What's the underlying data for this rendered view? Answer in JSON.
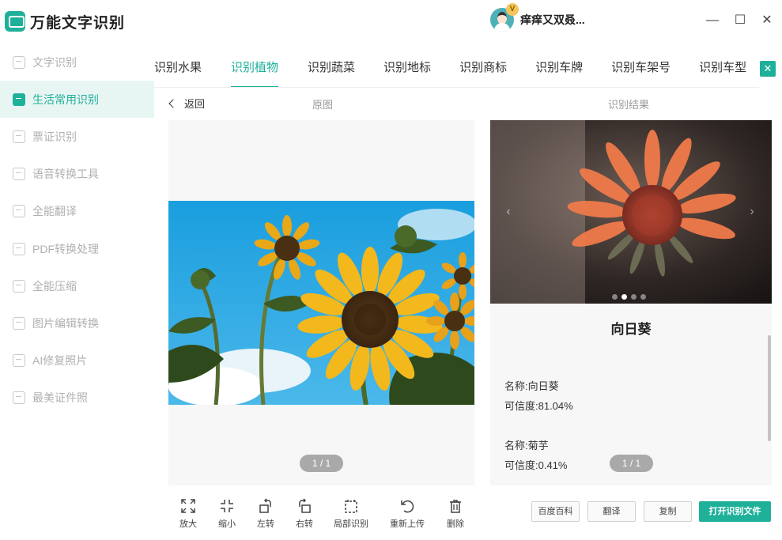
{
  "app": {
    "name": "万能文字识别"
  },
  "user": {
    "name": "痒痒又双叒...",
    "badge": "V"
  },
  "window": {
    "minimize": "—",
    "maximize": "☐",
    "close": "✕"
  },
  "sidebar": {
    "items": [
      {
        "label": "文字识别",
        "icon": "text-scan-icon"
      },
      {
        "label": "生活常用识别",
        "icon": "life-recognition-icon"
      },
      {
        "label": "票证识别",
        "icon": "ticket-scan-icon"
      },
      {
        "label": "语音转换工具",
        "icon": "voice-convert-icon"
      },
      {
        "label": "全能翻译",
        "icon": "translate-icon"
      },
      {
        "label": "PDF转换处理",
        "icon": "pdf-icon"
      },
      {
        "label": "全能压缩",
        "icon": "compress-icon"
      },
      {
        "label": "图片编辑转换",
        "icon": "image-edit-icon"
      },
      {
        "label": "AI修复照片",
        "icon": "ai-repair-icon"
      },
      {
        "label": "最美证件照",
        "icon": "id-photo-icon"
      }
    ]
  },
  "tabs": [
    {
      "label": "识别水果"
    },
    {
      "label": "识别植物"
    },
    {
      "label": "识别蔬菜"
    },
    {
      "label": "识别地标"
    },
    {
      "label": "识别商标"
    },
    {
      "label": "识别车牌"
    },
    {
      "label": "识别车架号"
    },
    {
      "label": "识别车型"
    }
  ],
  "tab_close": "✕",
  "subheader": {
    "back": "返回",
    "original": "原图",
    "result": "识别结果"
  },
  "left": {
    "page": "1 / 1"
  },
  "toolbar": [
    {
      "label": "放大",
      "icon": "zoom-in-icon"
    },
    {
      "label": "缩小",
      "icon": "zoom-out-icon"
    },
    {
      "label": "左转",
      "icon": "rotate-left-icon"
    },
    {
      "label": "右转",
      "icon": "rotate-right-icon"
    },
    {
      "label": "局部识别",
      "icon": "crop-icon"
    },
    {
      "label": "重新上传",
      "icon": "reupload-icon"
    },
    {
      "label": "删除",
      "icon": "delete-icon"
    }
  ],
  "result": {
    "title": "向日葵",
    "arrows": {
      "prev": "‹",
      "next": "›"
    },
    "items": [
      {
        "name": "名称:向日葵",
        "confidence": "可信度:81.04%"
      },
      {
        "name": "名称:菊芋",
        "confidence": "可信度:0.41%"
      }
    ],
    "page": "1 / 1"
  },
  "buttons": {
    "baike": "百度百科",
    "translate": "翻译",
    "copy": "复制",
    "open": "打开识别文件"
  },
  "colors": {
    "accent": "#1fb09a"
  }
}
